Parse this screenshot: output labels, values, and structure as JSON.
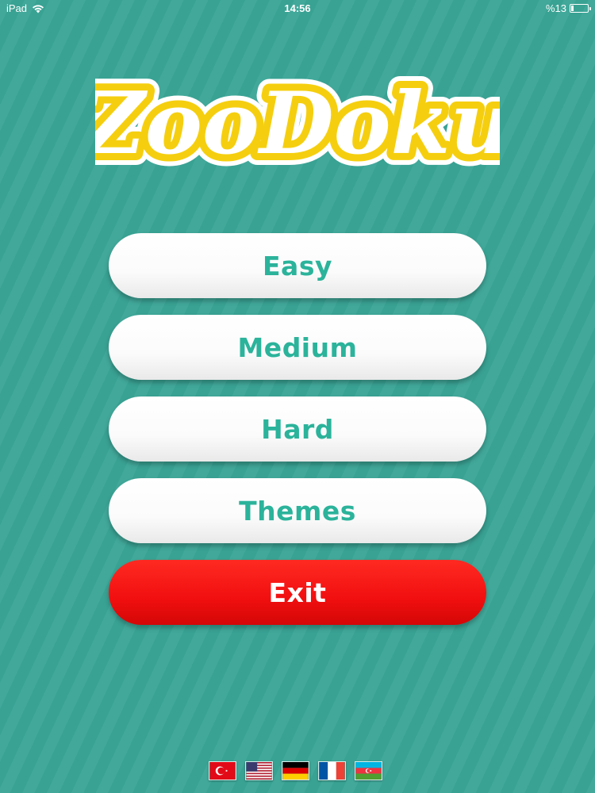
{
  "status_bar": {
    "device": "iPad",
    "time": "14:56",
    "battery": "%13"
  },
  "logo": {
    "text": "ZooDoku",
    "fill_color": "#ffffff",
    "outline_color": "#f5cf0f"
  },
  "menu": {
    "easy_label": "Easy",
    "medium_label": "Medium",
    "hard_label": "Hard",
    "themes_label": "Themes",
    "exit_label": "Exit"
  },
  "colors": {
    "background": "#3aa596",
    "button_text": "#2bb39b",
    "exit_button": "#f10f0f"
  },
  "languages": [
    {
      "name": "Turkish",
      "icon": "turkey-flag-icon"
    },
    {
      "name": "English",
      "icon": "us-flag-icon"
    },
    {
      "name": "German",
      "icon": "germany-flag-icon"
    },
    {
      "name": "French",
      "icon": "france-flag-icon"
    },
    {
      "name": "Azerbaijani",
      "icon": "azerbaijan-flag-icon"
    }
  ]
}
